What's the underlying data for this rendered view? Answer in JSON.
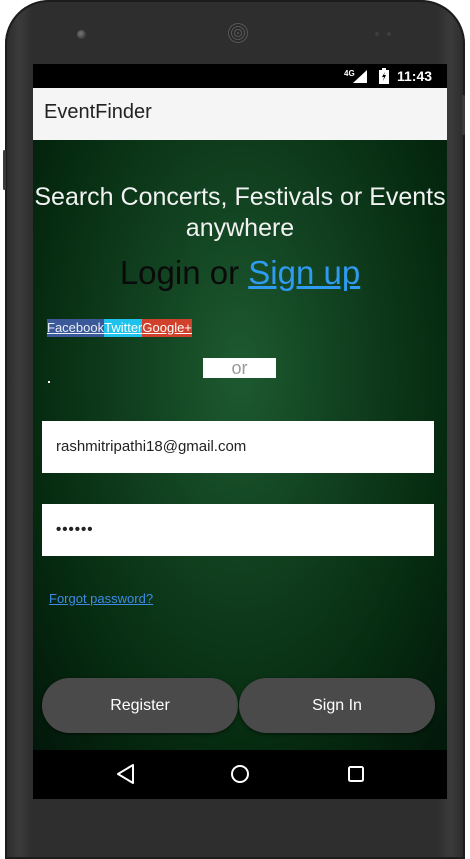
{
  "status_bar": {
    "network": "4G",
    "time": "11:43",
    "icons": [
      "signal-icon",
      "battery-icon"
    ]
  },
  "app_bar": {
    "title": "EventFinder"
  },
  "main": {
    "headline": "Search Concerts, Festivals or Events anywhere",
    "login_text": "Login or ",
    "signup_link": "Sign up",
    "social_buttons": {
      "facebook": "Facebook",
      "twitter": "Twitter",
      "google": "Google+"
    },
    "or_label": "or",
    "email": {
      "value": "rashmitripathi18@gmail.com"
    },
    "password": {
      "value": "••••••"
    },
    "forgot_password": "Forgot password?",
    "register_label": "Register",
    "signin_label": "Sign In"
  },
  "nav_bar": {
    "icons": [
      "back-icon",
      "home-icon",
      "recents-icon"
    ]
  },
  "colors": {
    "facebook": "#3b5998",
    "twitter": "#1dc2ed",
    "google": "#d1402b",
    "link": "#2f9bf0",
    "button": "#4a4a4a",
    "background_green": "#114120"
  }
}
